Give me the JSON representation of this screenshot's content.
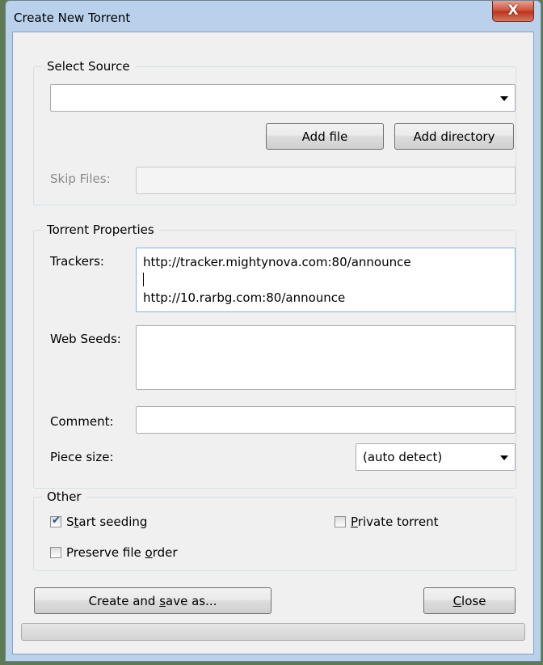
{
  "window": {
    "title": "Create New Torrent",
    "close_glyph": "X"
  },
  "select_source": {
    "legend": "Select Source",
    "source_value": "",
    "add_file_label": "Add file",
    "add_directory_label": "Add directory",
    "skip_files_label": "Skip Files:",
    "skip_files_value": ""
  },
  "torrent_properties": {
    "legend": "Torrent Properties",
    "trackers_label": "Trackers:",
    "trackers_lines": [
      "http://tracker.mightynova.com:80/announce",
      "",
      "http://10.rarbg.com:80/announce"
    ],
    "web_seeds_label": "Web Seeds:",
    "web_seeds_value": "",
    "comment_label": "Comment:",
    "comment_value": "",
    "piece_size_label": "Piece size:",
    "piece_size_value": "(auto detect)"
  },
  "other": {
    "legend": "Other",
    "start_seeding": {
      "pre": "S",
      "accel": "t",
      "post": "art seeding",
      "checked": true
    },
    "private_torrent": {
      "pre": "",
      "accel": "P",
      "post": "rivate torrent",
      "checked": false
    },
    "preserve_order": {
      "pre": "Preserve file ",
      "accel": "o",
      "post": "rder",
      "checked": false
    }
  },
  "actions": {
    "create_pre": "Create and ",
    "create_accel": "s",
    "create_post": "ave as...",
    "close_pre": "",
    "close_accel": "C",
    "close_post": "lose"
  },
  "progress": {
    "fraction": 0
  }
}
